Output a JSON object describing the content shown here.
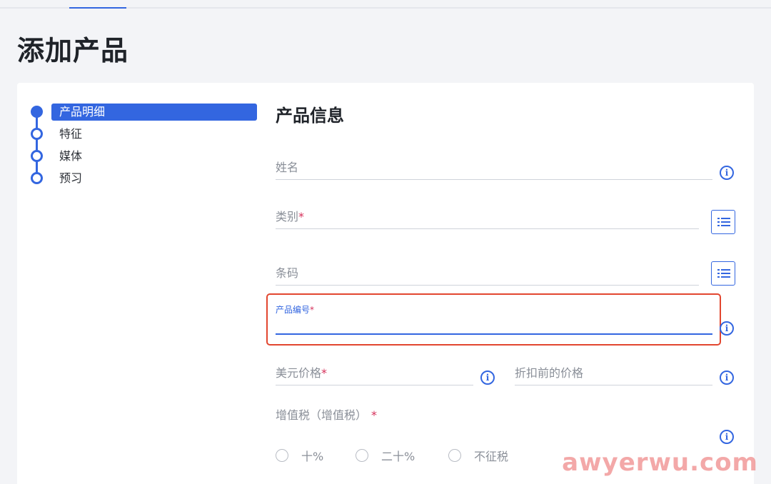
{
  "page": {
    "title": "添加产品"
  },
  "stepper": {
    "items": [
      {
        "label": "产品明细",
        "active": true
      },
      {
        "label": "特征",
        "active": false
      },
      {
        "label": "媒体",
        "active": false
      },
      {
        "label": "预习",
        "active": false
      }
    ]
  },
  "form": {
    "section_title": "产品信息",
    "name_label": "姓名",
    "category_label": "类别",
    "barcode_label": "条码",
    "product_code_label": "产品编号",
    "price_usd_label": "美元价格",
    "price_before_discount_label": "折扣前的价格",
    "vat_label": "增值税（增值税）",
    "required_mark": "*",
    "vat_options": [
      "十%",
      "二十%",
      "不征税"
    ]
  },
  "icons": {
    "info": "info-icon",
    "list": "list-icon",
    "info_glyph": "i"
  },
  "colors": {
    "accent": "#3366e0",
    "required": "#d6305a",
    "highlight_box": "#e2462f"
  },
  "watermark": "awyerwu.com"
}
